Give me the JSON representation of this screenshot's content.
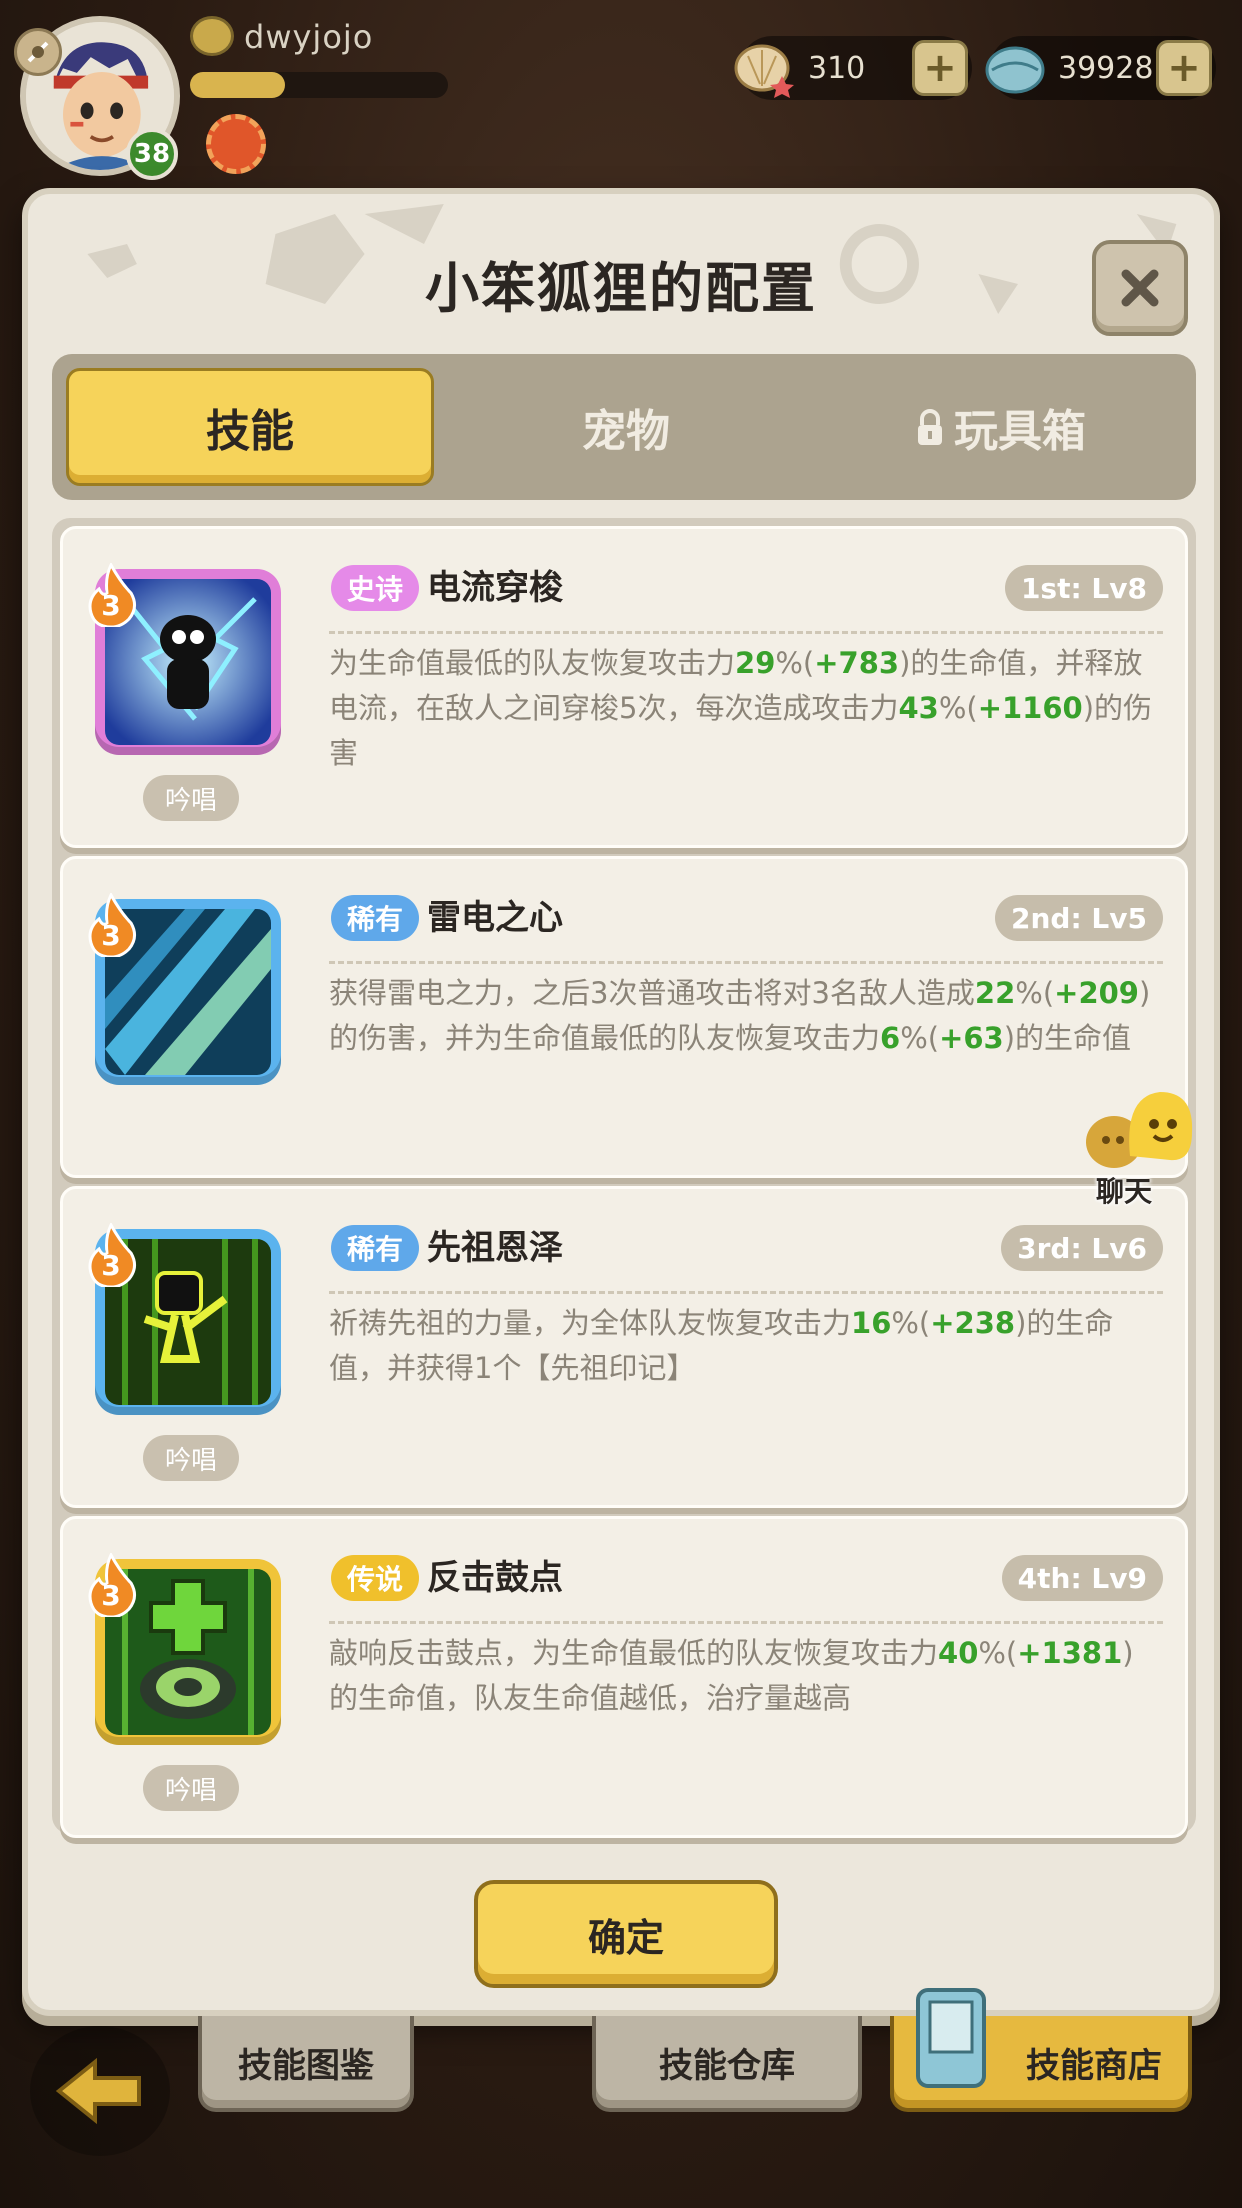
{
  "player": {
    "name": "dwyjojo",
    "level": "38",
    "xp_fraction": 0.37
  },
  "currencies": [
    {
      "icon": "shell-star-icon",
      "value": "310"
    },
    {
      "icon": "clam-icon",
      "value": "39928"
    }
  ],
  "modal": {
    "title": "小笨狐狸的配置",
    "tabs": [
      {
        "label": "技能",
        "active": true
      },
      {
        "label": "宠物",
        "active": false
      },
      {
        "label": "玩具箱",
        "active": false,
        "locked": true
      }
    ],
    "skills": [
      {
        "level": "3",
        "rarity": "史诗",
        "rarity_color": "#e58ae8",
        "name": "电流穿梭",
        "slot": "1st: Lv8",
        "frame_color": "#e07ed8",
        "chant": "吟唱",
        "desc": [
          {
            "t": "为生命值最低的队友恢复攻击力"
          },
          {
            "t": "29",
            "g": true
          },
          {
            "t": "%("
          },
          {
            "t": "+783",
            "g": true
          },
          {
            "t": ")的生命值，并释放电流，在敌人之间穿梭5次，每次造成攻击力"
          },
          {
            "t": "43",
            "g": true
          },
          {
            "t": "%("
          },
          {
            "t": "+1160",
            "g": true
          },
          {
            "t": ")的伤害"
          }
        ]
      },
      {
        "level": "3",
        "rarity": "稀有",
        "rarity_color": "#5fa8ea",
        "name": "雷电之心",
        "slot": "2nd: Lv5",
        "frame_color": "#5bb3ee",
        "chant": "",
        "desc": [
          {
            "t": "获得雷电之力，之后3次普通攻击将对3名敌人造成"
          },
          {
            "t": "22",
            "g": true
          },
          {
            "t": "%("
          },
          {
            "t": "+209",
            "g": true
          },
          {
            "t": ")的伤害，并为生命值最低的队友恢复攻击力"
          },
          {
            "t": "6",
            "g": true
          },
          {
            "t": "%("
          },
          {
            "t": "+63",
            "g": true
          },
          {
            "t": ")的生命值"
          }
        ]
      },
      {
        "level": "3",
        "rarity": "稀有",
        "rarity_color": "#5fa8ea",
        "name": "先祖恩泽",
        "slot": "3rd: Lv6",
        "frame_color": "#5bb3ee",
        "chant": "吟唱",
        "desc": [
          {
            "t": "祈祷先祖的力量，为全体队友恢复攻击力"
          },
          {
            "t": "16",
            "g": true
          },
          {
            "t": "%("
          },
          {
            "t": "+238",
            "g": true
          },
          {
            "t": ")的生命值，并获得1个【先祖印记】"
          }
        ]
      },
      {
        "level": "3",
        "rarity": "传说",
        "rarity_color": "#f0c02c",
        "name": "反击鼓点",
        "slot": "4th: Lv9",
        "frame_color": "#f0c43a",
        "chant": "吟唱",
        "desc": [
          {
            "t": "敲响反击鼓点，为生命值最低的队友恢复攻击力"
          },
          {
            "t": "40",
            "g": true
          },
          {
            "t": "%("
          },
          {
            "t": "+1381",
            "g": true
          },
          {
            "t": ")的生命值，队友生命值越低，治疗量越高"
          }
        ]
      }
    ],
    "confirm_label": "确定"
  },
  "chat": {
    "label": "聊天"
  },
  "bottom_nav": {
    "items": [
      "技能图鉴",
      "技能仓库",
      "技能商店"
    ]
  }
}
